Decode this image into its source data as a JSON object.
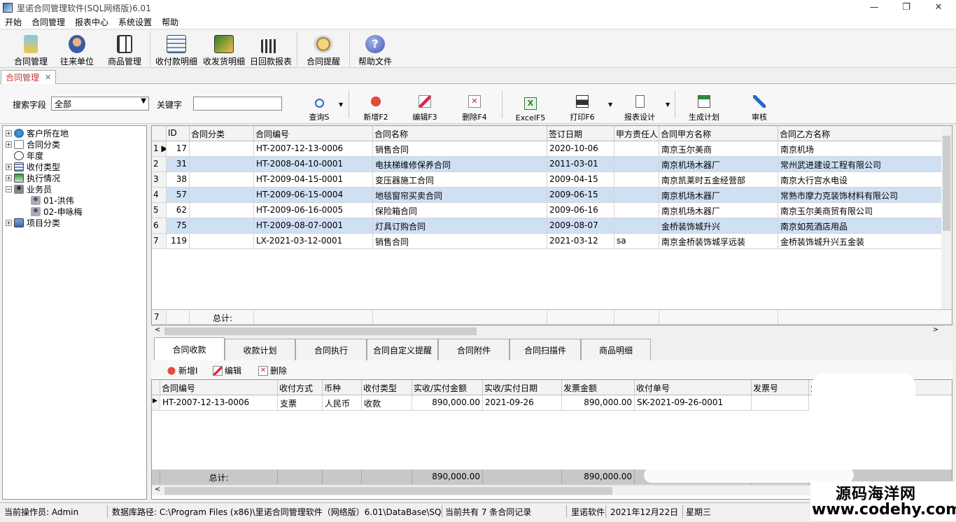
{
  "window": {
    "title": "里诺合同管理软件(SQL网络版)6.01",
    "minimize": "—",
    "restore": "❐",
    "close": "✕"
  },
  "menu": [
    "开始",
    "合同管理",
    "报表中心",
    "系统设置",
    "帮助"
  ],
  "toolbar": [
    {
      "label": "合同管理",
      "icon": "contract-icon"
    },
    {
      "label": "往来单位",
      "icon": "partner-icon"
    },
    {
      "label": "商品管理",
      "icon": "goods-icon"
    },
    {
      "label": "收付款明细",
      "icon": "payment-detail-icon"
    },
    {
      "label": "收发货明细",
      "icon": "shipment-detail-icon"
    },
    {
      "label": "日回款报表",
      "icon": "daily-report-icon"
    },
    {
      "label": "合同提醒",
      "icon": "reminder-icon"
    },
    {
      "label": "帮助文件",
      "icon": "help-icon"
    }
  ],
  "doc_tab": {
    "label": "合同管理",
    "close": "✕"
  },
  "search": {
    "field_label": "搜索字段",
    "field_value": "全部",
    "keyword_label": "关键字",
    "keyword_value": "",
    "buttons": [
      "查询S",
      "新增F2",
      "编辑F3",
      "删除F4",
      "ExcelF5",
      "打印F6",
      "报表设计",
      "生成计划",
      "审核"
    ]
  },
  "tree": [
    {
      "label": "客户所在地",
      "expander": "+"
    },
    {
      "label": "合同分类",
      "expander": "+"
    },
    {
      "label": "年度",
      "expander": ""
    },
    {
      "label": "收付类型",
      "expander": "+"
    },
    {
      "label": "执行情况",
      "expander": "+"
    },
    {
      "label": "业务员",
      "expander": "−"
    },
    {
      "label": "01-洪伟",
      "expander": ""
    },
    {
      "label": "02-申咏梅",
      "expander": ""
    },
    {
      "label": "项目分类",
      "expander": "+"
    }
  ],
  "contracts": {
    "columns": [
      "ID",
      "合同分类",
      "合同编号",
      "合同名称",
      "签订日期",
      "甲方责任人",
      "合同甲方名称",
      "合同乙方名称"
    ],
    "rows": [
      {
        "no": "1",
        "id": "17",
        "type": "",
        "code": "HT-2007-12-13-0006",
        "name": "销售合同",
        "date": "2020-10-06",
        "owner": "",
        "partyA": "南京玉尔美商",
        "partyB": "南京机场"
      },
      {
        "no": "2",
        "id": "31",
        "type": "",
        "code": "HT-2008-04-10-0001",
        "name": "电扶梯维修保养合同",
        "date": "2011-03-01",
        "owner": "",
        "partyA": "南京机场木器厂",
        "partyB": "常州武进建设工程有限公司"
      },
      {
        "no": "3",
        "id": "38",
        "type": "",
        "code": "HT-2009-04-15-0001",
        "name": "变压器施工合同",
        "date": "2009-04-15",
        "owner": "",
        "partyA": "南京凯莱时五金经营部",
        "partyB": "南京大行宫水电设"
      },
      {
        "no": "4",
        "id": "57",
        "type": "",
        "code": "HT-2009-06-15-0004",
        "name": "地毯窗帘买卖合同",
        "date": "2009-06-15",
        "owner": "",
        "partyA": "南京机场木器厂",
        "partyB": "常熟市摩力克装饰材料有限公司"
      },
      {
        "no": "5",
        "id": "62",
        "type": "",
        "code": "HT-2009-06-16-0005",
        "name": "保险箱合同",
        "date": "2009-06-16",
        "owner": "",
        "partyA": "南京机场木器厂",
        "partyB": "南京玉尔美商贸有限公司"
      },
      {
        "no": "6",
        "id": "75",
        "type": "",
        "code": "HT-2009-08-07-0001",
        "name": "灯具订购合同",
        "date": "2009-08-07",
        "owner": "",
        "partyA": "金桥装饰城升兴",
        "partyB": "南京如苑酒店用品"
      },
      {
        "no": "7",
        "id": "119",
        "type": "",
        "code": "LX-2021-03-12-0001",
        "name": "销售合同",
        "date": "2021-03-12",
        "owner": "sa",
        "partyA": "南京金桥装饰城孚远装",
        "partyB": "金桥装饰城升兴五金装"
      }
    ],
    "footer_count": "7",
    "footer_label": "总计:"
  },
  "detail_tabs": [
    "合同收款",
    "收款计划",
    "合同执行",
    "合同自定义提醒",
    "合同附件",
    "合同扫描件",
    "商品明细"
  ],
  "detail_toolbar": [
    "新增I",
    "编辑",
    "删除"
  ],
  "payments": {
    "columns": [
      "合同编号",
      "收付方式",
      "币种",
      "收付类型",
      "实收/实付金额",
      "实收/实付日期",
      "发票金额",
      "收付单号",
      "发票号",
      "业"
    ],
    "rows": [
      {
        "code": "HT-2007-12-13-0006",
        "method": "支票",
        "currency": "人民币",
        "type": "收款",
        "amount": "890,000.00",
        "date": "2021-09-26",
        "invoice_amount": "890,000.00",
        "voucher": "SK-2021-09-26-0001",
        "invoice_no": ""
      }
    ],
    "footer_label": "总计:",
    "footer_amount": "890,000.00",
    "footer_invoice": "890,000.00"
  },
  "status": {
    "operator": "当前操作员: Admin",
    "db_path": "数据库路径:  C:\\Program Files (x86)\\里诺合同管理软件（网络版）6.01\\DataBase\\SQL",
    "records": "当前共有 7 条合同记录",
    "vendor": "里诺软件",
    "date": "2021年12月22日",
    "weekday": "星期三"
  },
  "watermark": {
    "line1": "源码海洋网",
    "line2": "www.codehy.com"
  },
  "colors": {
    "selected_row": "#cfe0f3",
    "accent_red": "#c0392b"
  }
}
